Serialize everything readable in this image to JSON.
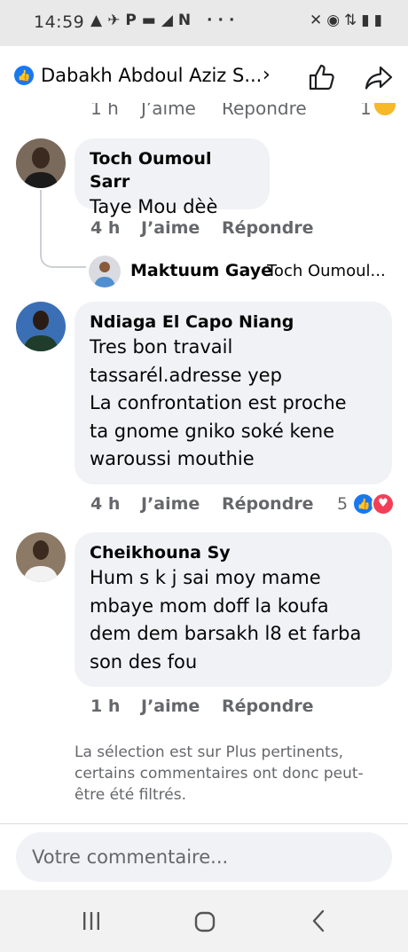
{
  "status_bar": {
    "time": "14:59",
    "left_icons": "▲✈P▬◢N ···",
    "right_icons": "✕◉⇅▮▮"
  },
  "header": {
    "title": "Dabakh Abdoul Aziz S...",
    "chevron": "›"
  },
  "previous_row": {
    "time": "1 h",
    "like": "J’aime",
    "reply": "Répondre",
    "reaction_count": "1"
  },
  "comments": [
    {
      "author": "Toch Oumoul Sarr",
      "text": "Taye Mou dèè",
      "time": "4 h",
      "like": "J’aime",
      "reply": "Répondre"
    },
    {
      "author": "Ndiaga El Capo Niang",
      "text": "Tres bon travail\ntassarél.adresse yep\nLa confrontation est proche\nta gnome gniko soké kene\nwaroussi mouthie",
      "time": "4 h",
      "like": "J’aime",
      "reply": "Répondre",
      "reaction_count": "5"
    },
    {
      "author": "Cheikhouna Sy",
      "text": "Hum s k j sai moy mame\nmbaye mom doff la koufa\ndem dem barsakh l8 et farba\nson des fou",
      "time": "1 h",
      "like": "J’aime",
      "reply": "Répondre"
    }
  ],
  "reply_preview": {
    "author": "Maktuum Gaye",
    "text": "Toch Oumoul..."
  },
  "filter_note": "La sélection est sur Plus pertinents, certains commentaires ont donc peut-être été filtrés.",
  "composer": {
    "placeholder": "Votre commentaire..."
  },
  "colors": {
    "accent": "#1877f2",
    "bubble": "#f0f2f5",
    "secondary_text": "#65676b",
    "love": "#f33e58"
  },
  "icons": [
    "like-badge-icon",
    "chevron-right-icon",
    "thumbs-up-icon",
    "share-arrow-icon",
    "recents-icon",
    "home-icon",
    "back-icon"
  ]
}
